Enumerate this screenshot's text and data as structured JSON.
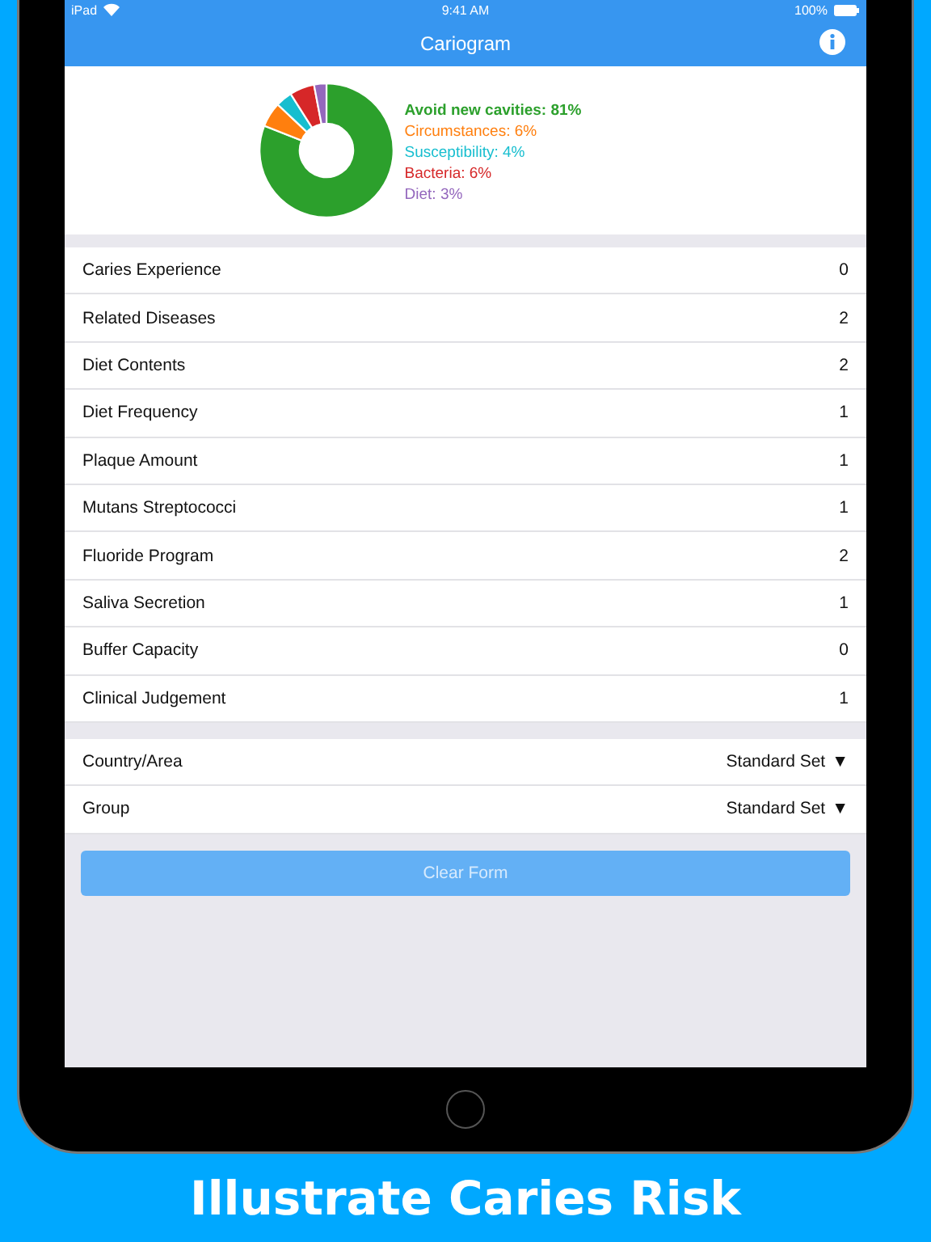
{
  "status_bar": {
    "device": "iPad",
    "time": "9:41 AM",
    "battery": "100%"
  },
  "nav": {
    "title": "Cariogram"
  },
  "chart": {
    "chart_data": {
      "type": "donut",
      "categories": [
        "Avoid new cavities: 81%",
        "Circumstances: 6%",
        "Susceptibility: 4%",
        "Bacteria: 6%",
        "Diet: 3%"
      ],
      "values": [
        81,
        6,
        4,
        6,
        3
      ],
      "colors": [
        "#2ca02c",
        "#ff7f0e",
        "#17becf",
        "#d62728",
        "#9467bd"
      ]
    }
  },
  "factors": [
    {
      "label": "Caries Experience",
      "value": "0"
    },
    {
      "label": "Related Diseases",
      "value": "2"
    },
    {
      "label": "Diet Contents",
      "value": "2"
    },
    {
      "label": "Diet Frequency",
      "value": "1"
    },
    {
      "label": "Plaque Amount",
      "value": "1"
    },
    {
      "label": "Mutans Streptococci",
      "value": "1"
    },
    {
      "label": "Fluoride Program",
      "value": "2"
    },
    {
      "label": "Saliva Secretion",
      "value": "1"
    },
    {
      "label": "Buffer Capacity",
      "value": "0"
    },
    {
      "label": "Clinical Judgement",
      "value": "1"
    }
  ],
  "settings": [
    {
      "label": "Country/Area",
      "value": "Standard Set",
      "caret": "▼"
    },
    {
      "label": "Group",
      "value": "Standard Set",
      "caret": "▼"
    }
  ],
  "clear_button": {
    "label": "Clear Form",
    "disabled": true
  },
  "caption": "Illustrate Caries Risk"
}
